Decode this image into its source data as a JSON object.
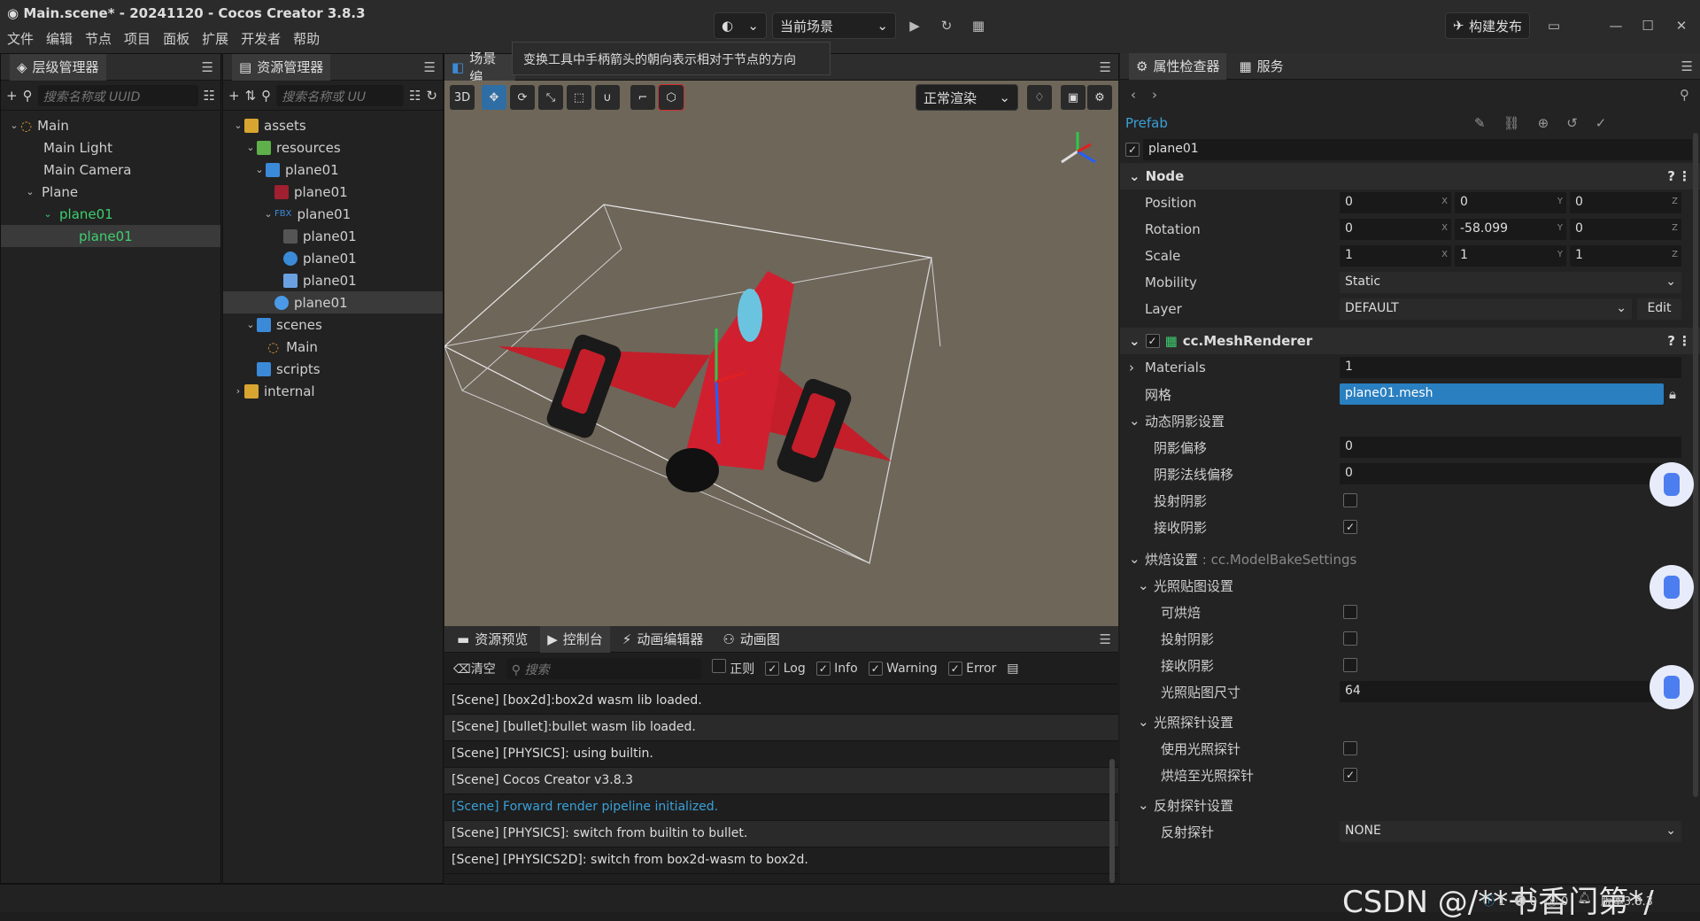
{
  "title": "Main.scene* - 20241120 - Cocos Creator 3.8.3",
  "menu": [
    "文件",
    "编辑",
    "节点",
    "项目",
    "面板",
    "扩展",
    "开发者",
    "帮助"
  ],
  "toolbar": {
    "scene_select": "当前场景",
    "build_publish": "构建发布"
  },
  "hierarchy": {
    "title": "层级管理器",
    "search_placeholder": "搜索名称或 UUID",
    "nodes": [
      "Main",
      "Main Light",
      "Main Camera",
      "Plane",
      "plane01",
      "plane01"
    ]
  },
  "assets": {
    "title": "资源管理器",
    "search_placeholder": "搜索名称或 UU",
    "items": [
      "assets",
      "resources",
      "plane01",
      "plane01",
      "plane01",
      "plane01",
      "plane01",
      "plane01",
      "plane01",
      "scenes",
      "Main",
      "scripts",
      "internal"
    ]
  },
  "scene": {
    "tab": "场景编",
    "tooltip": "变换工具中手柄箭头的朝向表示相对于节点的方向",
    "btn_3d": "3D",
    "render_mode": "正常渲染"
  },
  "console_panel": {
    "tabs": [
      "资源预览",
      "控制台",
      "动画编辑器",
      "动画图"
    ],
    "clear": "清空",
    "search_placeholder": "搜索",
    "filters": [
      "正则",
      "Log",
      "Info",
      "Warning",
      "Error"
    ],
    "filter_checked": [
      false,
      true,
      true,
      true,
      true
    ],
    "lines": [
      "[Scene] [box2d]:box2d wasm lib loaded.",
      "[Scene] [bullet]:bullet wasm lib loaded.",
      "[Scene] [PHYSICS]: using builtin.",
      "[Scene] Cocos Creator v3.8.3",
      "[Scene] Forward render pipeline initialized.",
      "[Scene] [PHYSICS]: switch from builtin to bullet.",
      "[Scene] [PHYSICS2D]: switch from box2d-wasm to box2d."
    ],
    "highlight_color": "#3aa0d8"
  },
  "inspector": {
    "tabs": [
      "属性检查器",
      "服务"
    ],
    "prefab_label": "Prefab",
    "node_name": "plane01",
    "node_section": "Node",
    "position_label": "Position",
    "position": [
      "0",
      "0",
      "0"
    ],
    "rotation_label": "Rotation",
    "rotation": [
      "0",
      "-58.099",
      "0"
    ],
    "scale_label": "Scale",
    "scale": [
      "1",
      "1",
      "1"
    ],
    "axes": [
      "X",
      "Y",
      "Z"
    ],
    "mobility_label": "Mobility",
    "mobility": "Static",
    "layer_label": "Layer",
    "layer": "DEFAULT",
    "edit": "Edit",
    "mesh_renderer": "cc.MeshRenderer",
    "materials_label": "Materials",
    "materials": "1",
    "mesh_label": "网格",
    "mesh": "plane01.mesh",
    "dyn_shadow": "动态阴影设置",
    "shadow_bias_label": "阴影偏移",
    "shadow_bias": "0",
    "shadow_normal_label": "阴影法线偏移",
    "shadow_normal": "0",
    "cast_shadow_label": "投射阴影",
    "recv_shadow_label": "接收阴影",
    "bake_label": "烘焙设置",
    "bake_type": ": cc.ModelBakeSettings",
    "lightmap_section": "光照贴图设置",
    "bakeable_label": "可烘焙",
    "lm_cast_label": "投射阴影",
    "lm_recv_label": "接收阴影",
    "lm_size_label": "光照贴图尺寸",
    "lm_size": "64",
    "probe_section": "光照探针设置",
    "use_probe_label": "使用光照探针",
    "bake_probe_label": "烘焙至光照探针",
    "reflect_section": "反射探针设置",
    "reflect_label": "反射探针",
    "reflect": "NONE"
  },
  "status": {
    "watermark": "CSDN @/**书香门第*/",
    "info": "1",
    "warn": "0",
    "err": "0",
    "version": "版本3.8.3"
  }
}
